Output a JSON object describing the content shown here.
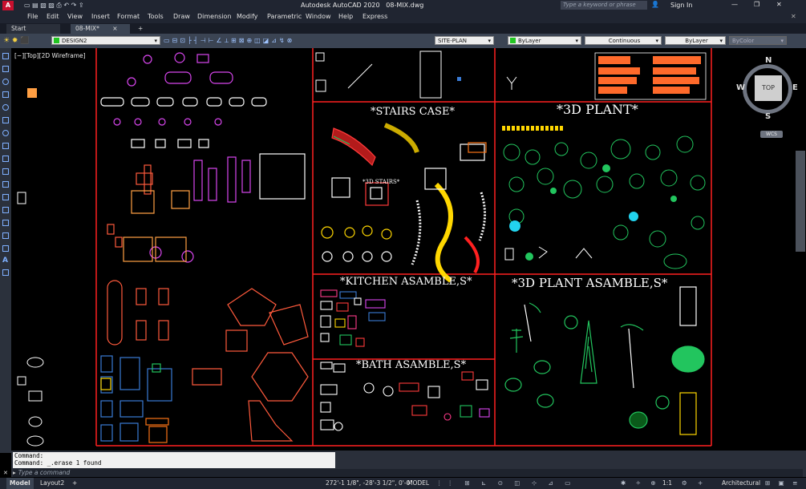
{
  "window": {
    "app_title": "Autodesk AutoCAD 2020",
    "file_name": "08-MIX.dwg",
    "search_placeholder": "Type a keyword or phrase",
    "sign_in": "Sign In"
  },
  "menu": [
    "File",
    "Edit",
    "View",
    "Insert",
    "Format",
    "Tools",
    "Draw",
    "Dimension",
    "Modify",
    "Parametric",
    "Window",
    "Help",
    "Express"
  ],
  "doc_tabs": {
    "start": "Start",
    "active": "08-MIX*",
    "add": "+"
  },
  "ribbon": {
    "layer_name": "DESIGN2",
    "style_dropdown": "SITE-PLAN",
    "color": "ByLayer",
    "linetype": "Continuous",
    "lineweight": "ByLayer",
    "plotstyle": "ByColor"
  },
  "viewport": {
    "view_label": "[−][Top][2D Wireframe]",
    "viewcube": {
      "north": "N",
      "south": "S",
      "east": "E",
      "west": "W",
      "top": "TOP",
      "wcs": "WCS"
    },
    "sections": {
      "stairs": "*STAIRS CASE*",
      "stairs_3d": "*3D STAIRS*",
      "plant": "*3D PLANT*",
      "kitchen": "*KITCHEN ASAMBLE,S*",
      "bath": "*BATH ASAMBLE,S*",
      "plant_assembly": "*3D PLANT  ASAMBLE,S*"
    }
  },
  "command": {
    "line1": "Command:",
    "line2": "Command: _.erase 1 found",
    "placeholder": "Type a command"
  },
  "status": {
    "tab_model": "Model",
    "tab_layout": "Layout2",
    "coordinates": "272'-1 1/8\", -28'-3 1/2\", 0'-0\"",
    "mode": "MODEL",
    "scale": "1:1",
    "units": "Architectural"
  },
  "colors": {
    "frame_red": "#ff2020",
    "accent_blue": "#3a7bd5"
  }
}
